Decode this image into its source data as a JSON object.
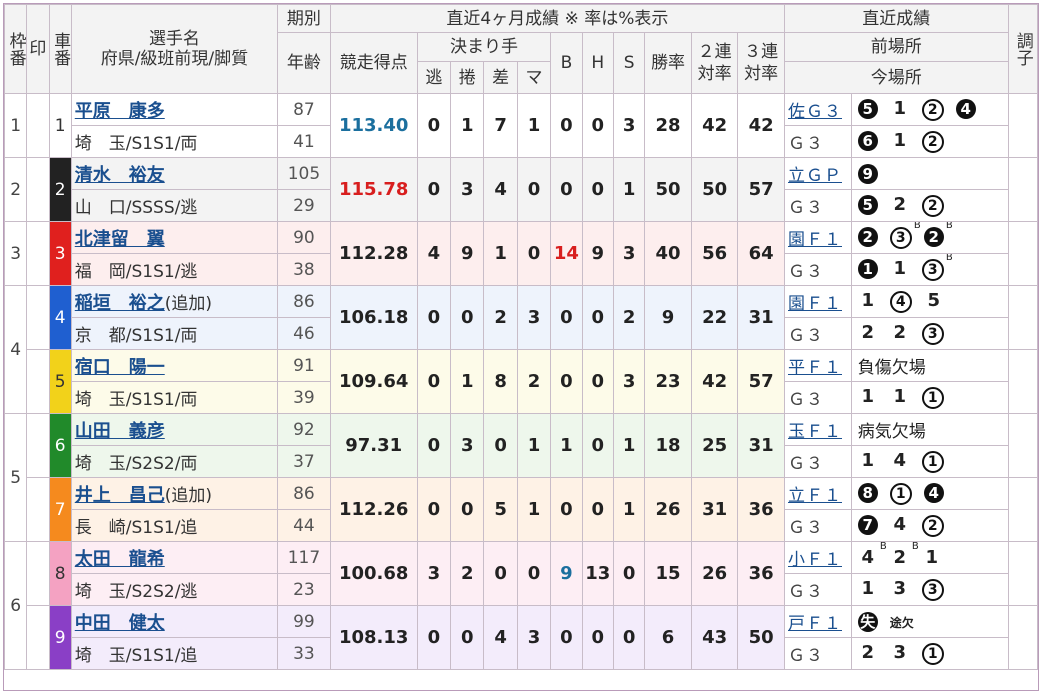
{
  "header": {
    "frame_no": "枠番",
    "mark": "印",
    "car_no": "車番",
    "name_title": "選手名",
    "name_sub": "府県/級班前現/脚質",
    "term": "期別",
    "age": "年齢",
    "recent4m": "直近4ヶ月成績 ※ 率は%表示",
    "score": "競走得点",
    "kimarite": "決まり手",
    "nige": "逃",
    "makuri": "捲",
    "sashi": "差",
    "mark_m": "マ",
    "b": "B",
    "h": "H",
    "s": "S",
    "win_rate": "勝率",
    "ren2": "２連対率",
    "ren3": "３連対率",
    "recent": "直近成績",
    "prev": "前場所",
    "curr": "今場所",
    "cond": "調子"
  },
  "colors": {
    "car1": "#ffffff",
    "car2": "#222222",
    "car3": "#e0201e",
    "car4": "#1f5fd0",
    "car5": "#f2d21a",
    "car6": "#218a2a",
    "car7": "#f58a1e",
    "car8": "#f4a2c2",
    "car9": "#8a3fc6",
    "row1": "#ffffff",
    "row2": "#f3f3f3",
    "row3": "#fdeeee",
    "row4": "#eef3fc",
    "row5": "#fdfbe9",
    "row6": "#eef7ec",
    "row7": "#fef2e6",
    "row8": "#fdeef4",
    "row9": "#f3ecfb",
    "score_blue": "#1b6f9e",
    "score_red": "#d81e1e",
    "link": "#1a4f8f"
  },
  "rows": [
    {
      "car": "1",
      "name": "平原　康多",
      "add": "",
      "pref": "埼　玉/S1S1/両",
      "term": "87",
      "age": "41",
      "score": "113.40",
      "score_color": "blue",
      "nige": "0",
      "makuri": "1",
      "sashi": "7",
      "mark": "1",
      "b": "0",
      "h": "0",
      "s": "3",
      "win": "28",
      "r2": "42",
      "r3": "42",
      "prev_place": "佐Ｇ３",
      "prev_res": [
        {
          "t": "5",
          "s": "f"
        },
        {
          "t": "1",
          "s": "p"
        },
        {
          "t": "2",
          "s": "o"
        },
        {
          "t": "4",
          "s": "f"
        }
      ],
      "curr_place": "Ｇ３",
      "curr_res": [
        {
          "t": "6",
          "s": "f"
        },
        {
          "t": "1",
          "s": "p"
        },
        {
          "t": "2",
          "s": "o"
        }
      ]
    },
    {
      "car": "2",
      "name": "清水　裕友",
      "add": "",
      "pref": "山　口/SSSS/逃",
      "term": "105",
      "age": "29",
      "score": "115.78",
      "score_color": "red",
      "nige": "0",
      "makuri": "3",
      "sashi": "4",
      "mark": "0",
      "b": "0",
      "h": "0",
      "s": "1",
      "win": "50",
      "r2": "50",
      "r3": "57",
      "prev_place": "立ＧＰ",
      "prev_res": [
        {
          "t": "9",
          "s": "f"
        }
      ],
      "curr_place": "Ｇ３",
      "curr_res": [
        {
          "t": "5",
          "s": "f"
        },
        {
          "t": "2",
          "s": "p"
        },
        {
          "t": "2",
          "s": "o"
        }
      ]
    },
    {
      "car": "3",
      "name": "北津留　翼",
      "add": "",
      "pref": "福　岡/S1S1/逃",
      "term": "90",
      "age": "38",
      "score": "112.28",
      "score_color": "",
      "nige": "4",
      "makuri": "9",
      "sashi": "1",
      "mark": "0",
      "b": "14",
      "b_red": true,
      "h": "9",
      "s": "3",
      "win": "40",
      "r2": "56",
      "r3": "64",
      "prev_place": "園Ｆ１",
      "prev_res": [
        {
          "t": "2",
          "s": "f"
        },
        {
          "t": "3",
          "s": "o",
          "sup": "B"
        },
        {
          "t": "2",
          "s": "f",
          "sup": "B"
        }
      ],
      "curr_place": "Ｇ３",
      "curr_res": [
        {
          "t": "1",
          "s": "f"
        },
        {
          "t": "1",
          "s": "p"
        },
        {
          "t": "3",
          "s": "o",
          "sup": "B"
        }
      ]
    },
    {
      "car": "4",
      "name": "稲垣　裕之",
      "add": "(追加)",
      "pref": "京　都/S1S1/両",
      "term": "86",
      "age": "46",
      "score": "106.18",
      "score_color": "",
      "nige": "0",
      "makuri": "0",
      "sashi": "2",
      "mark": "3",
      "b": "0",
      "h": "0",
      "s": "2",
      "win": "9",
      "r2": "22",
      "r3": "31",
      "prev_place": "園Ｆ１",
      "prev_res": [
        {
          "t": "1",
          "s": "p"
        },
        {
          "t": "4",
          "s": "o"
        },
        {
          "t": "5",
          "s": "p"
        }
      ],
      "curr_place": "Ｇ３",
      "curr_res": [
        {
          "t": "2",
          "s": "p"
        },
        {
          "t": "2",
          "s": "p"
        },
        {
          "t": "3",
          "s": "o"
        }
      ]
    },
    {
      "car": "5",
      "name": "宿口　陽一",
      "add": "",
      "pref": "埼　玉/S1S1/両",
      "term": "91",
      "age": "39",
      "score": "109.64",
      "score_color": "",
      "nige": "0",
      "makuri": "1",
      "sashi": "8",
      "mark": "2",
      "b": "0",
      "h": "0",
      "s": "3",
      "win": "23",
      "r2": "42",
      "r3": "57",
      "prev_place": "平Ｆ１",
      "prev_text": "負傷欠場",
      "prev_res": [],
      "curr_place": "Ｇ３",
      "curr_res": [
        {
          "t": "1",
          "s": "p"
        },
        {
          "t": "1",
          "s": "p"
        },
        {
          "t": "1",
          "s": "o"
        }
      ]
    },
    {
      "car": "6",
      "name": "山田　義彦",
      "add": "",
      "pref": "埼　玉/S2S2/両",
      "term": "92",
      "age": "37",
      "score": "97.31",
      "score_color": "",
      "nige": "0",
      "makuri": "3",
      "sashi": "0",
      "mark": "1",
      "b": "1",
      "h": "0",
      "s": "1",
      "win": "18",
      "r2": "25",
      "r3": "31",
      "prev_place": "玉Ｆ１",
      "prev_text": "病気欠場",
      "prev_res": [],
      "curr_place": "Ｇ３",
      "curr_res": [
        {
          "t": "1",
          "s": "p"
        },
        {
          "t": "4",
          "s": "p"
        },
        {
          "t": "1",
          "s": "o"
        }
      ]
    },
    {
      "car": "7",
      "name": "井上　昌己",
      "add": "(追加)",
      "pref": "長　崎/S1S1/追",
      "term": "86",
      "age": "44",
      "score": "112.26",
      "score_color": "",
      "nige": "0",
      "makuri": "0",
      "sashi": "5",
      "mark": "1",
      "b": "0",
      "h": "0",
      "s": "1",
      "win": "26",
      "r2": "31",
      "r3": "36",
      "prev_place": "立Ｆ１",
      "prev_res": [
        {
          "t": "8",
          "s": "f"
        },
        {
          "t": "1",
          "s": "o"
        },
        {
          "t": "4",
          "s": "f"
        }
      ],
      "curr_place": "Ｇ３",
      "curr_res": [
        {
          "t": "7",
          "s": "f"
        },
        {
          "t": "4",
          "s": "p"
        },
        {
          "t": "2",
          "s": "o"
        }
      ]
    },
    {
      "car": "8",
      "name": "太田　龍希",
      "add": "",
      "pref": "埼　玉/S2S2/逃",
      "term": "117",
      "age": "23",
      "score": "100.68",
      "score_color": "",
      "nige": "3",
      "makuri": "2",
      "sashi": "0",
      "mark": "0",
      "b": "9",
      "b_blue": true,
      "h": "13",
      "s": "0",
      "win": "15",
      "r2": "26",
      "r3": "36",
      "prev_place": "小Ｆ１",
      "prev_res": [
        {
          "t": "4",
          "s": "p",
          "sup": "B"
        },
        {
          "t": "2",
          "s": "p",
          "sup": "B"
        },
        {
          "t": "1",
          "s": "p"
        }
      ],
      "curr_place": "Ｇ３",
      "curr_res": [
        {
          "t": "1",
          "s": "p"
        },
        {
          "t": "3",
          "s": "p"
        },
        {
          "t": "3",
          "s": "o"
        }
      ]
    },
    {
      "car": "9",
      "name": "中田　健太",
      "add": "",
      "pref": "埼　玉/S1S1/追",
      "term": "99",
      "age": "33",
      "score": "108.13",
      "score_color": "",
      "nige": "0",
      "makuri": "0",
      "sashi": "4",
      "mark": "3",
      "b": "0",
      "h": "0",
      "s": "0",
      "win": "6",
      "r2": "43",
      "r3": "50",
      "prev_place": "戸Ｆ１",
      "prev_res": [
        {
          "t": "失",
          "s": "f"
        },
        {
          "t": "途欠",
          "s": "small"
        }
      ],
      "curr_place": "Ｇ３",
      "curr_res": [
        {
          "t": "2",
          "s": "p"
        },
        {
          "t": "3",
          "s": "p"
        },
        {
          "t": "1",
          "s": "o"
        }
      ]
    }
  ],
  "frames": [
    {
      "no": "1",
      "span": 1
    },
    {
      "no": "2",
      "span": 1
    },
    {
      "no": "3",
      "span": 1
    },
    {
      "no": "4",
      "span": 2
    },
    {
      "no": "5",
      "span": 2
    },
    {
      "no": "6",
      "span": 2
    }
  ]
}
